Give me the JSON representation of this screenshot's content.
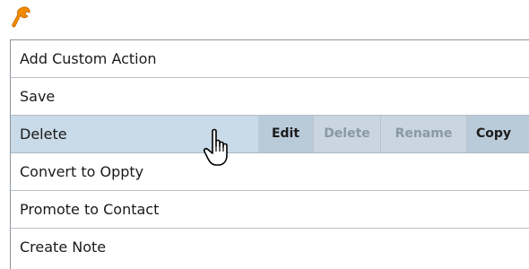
{
  "icons": {
    "toolbar": "wrench-icon",
    "pointer": "hand-pointer-cursor"
  },
  "colors": {
    "accent_wrench": "#f08a00",
    "active_row": "#c9dae8",
    "action_enabled": "#b9cad9",
    "action_disabled": "#c9d6e2"
  },
  "menu": {
    "items": [
      {
        "label": "Add Custom Action"
      },
      {
        "label": "Save"
      },
      {
        "label": "Delete"
      },
      {
        "label": "Convert to Oppty"
      },
      {
        "label": "Promote to Contact"
      },
      {
        "label": "Create Note"
      }
    ],
    "active_index": 2
  },
  "row_actions": {
    "edit": "Edit",
    "delete": "Delete",
    "rename": "Rename",
    "copy": "Copy"
  }
}
